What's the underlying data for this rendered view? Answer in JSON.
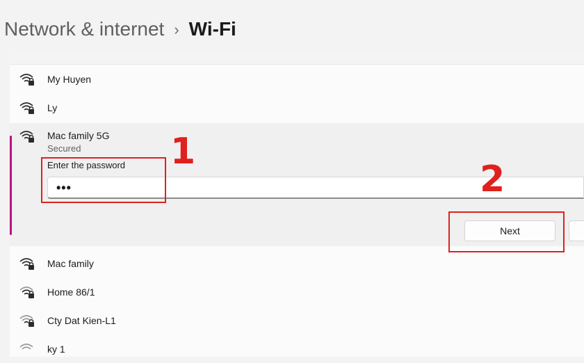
{
  "breadcrumb": {
    "parent": "Network & internet",
    "separator": "›",
    "current": "Wi-Fi"
  },
  "networks_above": [
    {
      "name": "My Huyen",
      "icon": "wifi-secured-icon"
    },
    {
      "name": "Ly",
      "icon": "wifi-secured-icon"
    }
  ],
  "selected_network": {
    "name": "Mac family 5G",
    "status": "Secured",
    "password_label": "Enter the password",
    "password_value": "•••",
    "next_label": "Next",
    "accent_color": "#b8127e"
  },
  "networks_below": [
    {
      "name": "Mac family",
      "icon": "wifi-secured-icon"
    },
    {
      "name": "Home 86/1",
      "icon": "wifi-secured-icon"
    },
    {
      "name": "Cty Dat Kien-L1",
      "icon": "wifi-secured-icon"
    },
    {
      "name": "ky 1",
      "icon": "wifi-secured-icon"
    }
  ],
  "annotations": {
    "step1": "1",
    "step2": "2",
    "color": "#e0201c"
  }
}
